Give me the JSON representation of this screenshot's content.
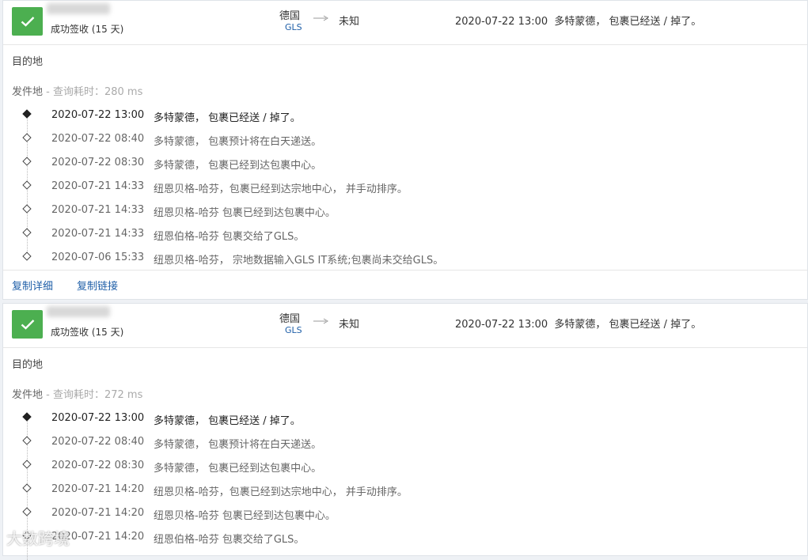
{
  "cards": [
    {
      "status": "成功签收 (15 天)",
      "origin_country": "德国",
      "carrier": "GLS",
      "destination": "未知",
      "latest_time": "2020-07-22 13:00",
      "latest_desc": "多特蒙德， 包裹已经送 / 掉了。",
      "destination_label": "目的地",
      "origin_label": "发件地",
      "query_note": " - 查询耗时：280 ms",
      "events": [
        {
          "time": "2020-07-22 13:00",
          "desc": "多特蒙德， 包裹已经送 / 掉了。"
        },
        {
          "time": "2020-07-22 08:40",
          "desc": "多特蒙德， 包裹预计将在白天递送。"
        },
        {
          "time": "2020-07-22 08:30",
          "desc": "多特蒙德， 包裹已经到达包裹中心。"
        },
        {
          "time": "2020-07-21 14:33",
          "desc": "纽恩贝格-哈芬，包裹已经到达宗地中心， 并手动排序。"
        },
        {
          "time": "2020-07-21 14:33",
          "desc": "纽恩贝格-哈芬 包裹已经到达包裹中心。"
        },
        {
          "time": "2020-07-21 14:33",
          "desc": "纽恩伯格-哈芬 包裹交给了GLS。"
        },
        {
          "time": "2020-07-06 15:33",
          "desc": "纽恩贝格-哈芬， 宗地数据输入GLS IT系统;包裹尚未交给GLS。"
        }
      ],
      "actions": {
        "copy_detail": "复制详细",
        "copy_link": "复制链接"
      }
    },
    {
      "status": "成功签收 (15 天)",
      "origin_country": "德国",
      "carrier": "GLS",
      "destination": "未知",
      "latest_time": "2020-07-22 13:00",
      "latest_desc": "多特蒙德， 包裹已经送 / 掉了。",
      "destination_label": "目的地",
      "origin_label": "发件地",
      "query_note": " - 查询耗时：272 ms",
      "events": [
        {
          "time": "2020-07-22 13:00",
          "desc": "多特蒙德， 包裹已经送 / 掉了。"
        },
        {
          "time": "2020-07-22 08:40",
          "desc": "多特蒙德， 包裹预计将在白天递送。"
        },
        {
          "time": "2020-07-22 08:30",
          "desc": "多特蒙德， 包裹已经到达包裹中心。"
        },
        {
          "time": "2020-07-21 14:20",
          "desc": "纽恩贝格-哈芬，包裹已经到达宗地中心， 并手动排序。"
        },
        {
          "time": "2020-07-21 14:20",
          "desc": "纽恩贝格-哈芬 包裹已经到达包裹中心。"
        },
        {
          "time": "2020-07-21 14:20",
          "desc": "纽恩伯格-哈芬 包裹交给了GLS。"
        }
      ]
    }
  ],
  "watermark": "大数跨境",
  "colors": {
    "success": "#4caf50",
    "link": "#1f5fa8"
  }
}
